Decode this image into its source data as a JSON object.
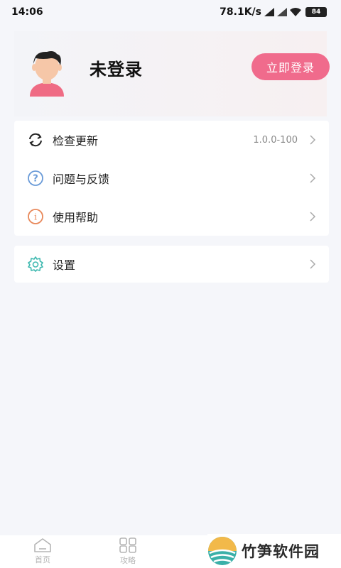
{
  "status_bar": {
    "time": "14:06",
    "net_speed": "78.1K/s",
    "battery": "84"
  },
  "profile": {
    "username": "未登录",
    "login_button": "立即登录"
  },
  "menu": {
    "items": [
      {
        "label": "检查更新",
        "value": "1.0.0-100",
        "icon": "refresh-icon"
      },
      {
        "label": "问题与反馈",
        "value": "",
        "icon": "question-icon"
      },
      {
        "label": "使用帮助",
        "value": "",
        "icon": "info-icon"
      }
    ],
    "settings": {
      "label": "设置",
      "icon": "gear-icon"
    }
  },
  "bottom_nav": {
    "items": [
      {
        "label": "首页",
        "icon": "home-icon"
      },
      {
        "label": "攻略",
        "icon": "grid-icon"
      }
    ]
  },
  "watermark": {
    "text": "竹笋软件园"
  },
  "colors": {
    "accent": "#f06b8c",
    "background": "#f5f6fa",
    "question_icon": "#6a9bd8",
    "info_icon": "#e8885a",
    "gear_icon": "#3fb9b0"
  }
}
